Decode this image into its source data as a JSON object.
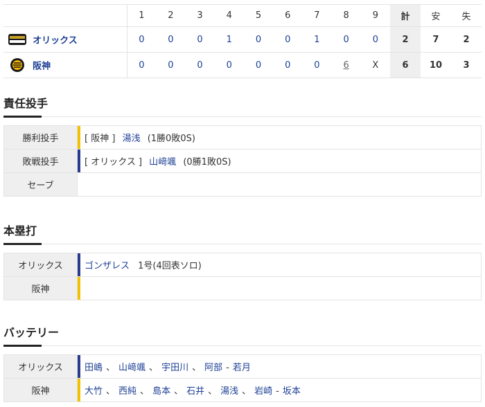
{
  "scoreboard": {
    "headers": [
      "1",
      "2",
      "3",
      "4",
      "5",
      "6",
      "7",
      "8",
      "9",
      "計",
      "安",
      "失"
    ],
    "teams": [
      {
        "name": "オリックス",
        "innings": [
          "0",
          "0",
          "0",
          "1",
          "0",
          "0",
          "1",
          "0",
          "0"
        ],
        "runs": "2",
        "hits": "7",
        "errors": "2",
        "logo_color": "#1a1a1a"
      },
      {
        "name": "阪神",
        "innings": [
          "0",
          "0",
          "0",
          "0",
          "0",
          "0",
          "0",
          "6",
          "X"
        ],
        "runs": "6",
        "hits": "10",
        "errors": "3",
        "logo_color": "#f5b400"
      }
    ]
  },
  "pitchers": {
    "title": "責任投手",
    "rows": [
      {
        "label": "勝利投手",
        "team": "[ 阪神 ]",
        "player": "湯浅",
        "record": "(1勝0敗0S)"
      },
      {
        "label": "敗戦投手",
        "team": "[ オリックス ]",
        "player": "山﨑颯",
        "record": "(0勝1敗0S)"
      },
      {
        "label": "セーブ",
        "team": "",
        "player": "",
        "record": ""
      }
    ]
  },
  "homeruns": {
    "title": "本塁打",
    "rows": [
      {
        "label": "オリックス",
        "player": "ゴンザレス",
        "detail": "1号(4回表ソロ)"
      },
      {
        "label": "阪神",
        "player": "",
        "detail": ""
      }
    ]
  },
  "battery": {
    "title": "バッテリー",
    "rows": [
      {
        "label": "オリックス",
        "pitchers": [
          "田嶋",
          "山﨑颯",
          "宇田川",
          "阿部"
        ],
        "catcher": "若月"
      },
      {
        "label": "阪神",
        "pitchers": [
          "大竹",
          "西純",
          "島本",
          "石井",
          "湯浅",
          "岩崎"
        ],
        "catcher": "坂本"
      }
    ]
  },
  "colors": {
    "link": "#1c3f94",
    "tigers_accent": "#f2c200",
    "buffaloes_accent": "#2a3a8c"
  }
}
